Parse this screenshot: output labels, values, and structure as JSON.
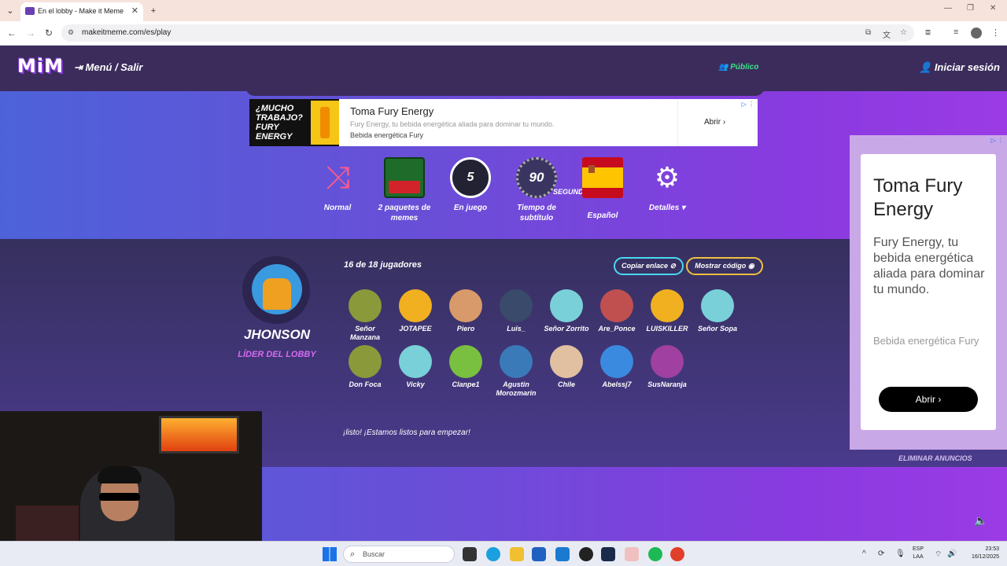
{
  "browser": {
    "tab_title": "En el lobby - Make it Meme",
    "url": "makeitmeme.com/es/play"
  },
  "nav": {
    "logo": "MiM",
    "menu": "Menú / Salir",
    "public": "Público",
    "login": "Iniciar sesión"
  },
  "ad_top": {
    "image_text": "¿MUCHO TRABAJO? FURY ENERGY",
    "title": "Toma Fury Energy",
    "description": "Fury Energy, tu bebida energética aliada para dominar tu mundo.",
    "sponsor": "Bebida energética Fury",
    "cta": "Abrir"
  },
  "settings": [
    {
      "label": "Normal"
    },
    {
      "label": "2 paquetes de memes"
    },
    {
      "label": "En juego",
      "icon_text": "5"
    },
    {
      "label": "Tiempo de subtítulo",
      "icon_text": "90",
      "unit": "SEGUNDO"
    },
    {
      "label": "Español"
    },
    {
      "label": "Detalles"
    }
  ],
  "lobby": {
    "host_name": "JHONSON",
    "host_role": "LÍDER DEL LOBBY",
    "count": "16 de  18 jugadores",
    "copy_link": "Copiar enlace",
    "show_code": "Mostrar código",
    "ready_text": "¡listo! ¡Estamos listos para empezar!",
    "players": [
      {
        "name": "Señor Manzana",
        "color": "#8a9a3a"
      },
      {
        "name": "JOTAPEE",
        "color": "#f0b020"
      },
      {
        "name": "Piero",
        "color": "#d89a6a"
      },
      {
        "name": "Luis_",
        "color": "#3a4a6a"
      },
      {
        "name": "Señor Zorrito",
        "color": "#7ad0d8"
      },
      {
        "name": "Are_Ponce",
        "color": "#c05050"
      },
      {
        "name": "LUISKILLER",
        "color": "#f0b020"
      },
      {
        "name": "Señor Sopa",
        "color": "#7ad0d8"
      },
      {
        "name": "Don Foca",
        "color": "#8a9a3a"
      },
      {
        "name": "Vicky",
        "color": "#7ad0d8"
      },
      {
        "name": "Clanpe1",
        "color": "#7ac040"
      },
      {
        "name": "Agustin Morozmarin",
        "color": "#3a7ab8"
      },
      {
        "name": "Chile",
        "color": "#e0c0a0"
      },
      {
        "name": "Abelssj7",
        "color": "#3a8ae0"
      },
      {
        "name": "SusNaranja",
        "color": "#a040a0"
      }
    ]
  },
  "ad_side": {
    "title": "Toma Fury Energy",
    "description": "Fury Energy, tu bebida energética aliada para dominar tu mundo.",
    "sponsor": "Bebida energética Fury",
    "cta": "Abrir",
    "remove_ads": "ELIMINAR ANUNCIOS"
  },
  "taskbar": {
    "search": "Buscar",
    "lang_top": "ESP",
    "lang_bottom": "LAA",
    "time": "23:53",
    "date": "16/12/2025"
  }
}
